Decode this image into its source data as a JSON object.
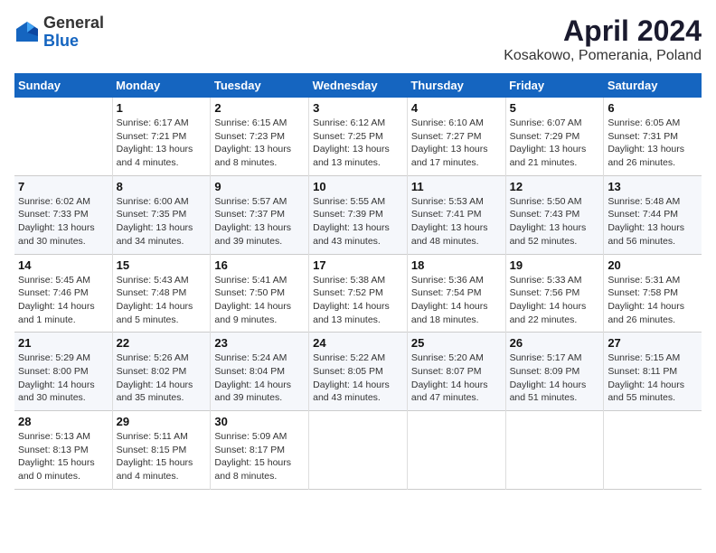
{
  "header": {
    "logo_general": "General",
    "logo_blue": "Blue",
    "title": "April 2024",
    "subtitle": "Kosakowo, Pomerania, Poland"
  },
  "days_of_week": [
    "Sunday",
    "Monday",
    "Tuesday",
    "Wednesday",
    "Thursday",
    "Friday",
    "Saturday"
  ],
  "weeks": [
    [
      {
        "day": "",
        "info": ""
      },
      {
        "day": "1",
        "info": "Sunrise: 6:17 AM\nSunset: 7:21 PM\nDaylight: 13 hours\nand 4 minutes."
      },
      {
        "day": "2",
        "info": "Sunrise: 6:15 AM\nSunset: 7:23 PM\nDaylight: 13 hours\nand 8 minutes."
      },
      {
        "day": "3",
        "info": "Sunrise: 6:12 AM\nSunset: 7:25 PM\nDaylight: 13 hours\nand 13 minutes."
      },
      {
        "day": "4",
        "info": "Sunrise: 6:10 AM\nSunset: 7:27 PM\nDaylight: 13 hours\nand 17 minutes."
      },
      {
        "day": "5",
        "info": "Sunrise: 6:07 AM\nSunset: 7:29 PM\nDaylight: 13 hours\nand 21 minutes."
      },
      {
        "day": "6",
        "info": "Sunrise: 6:05 AM\nSunset: 7:31 PM\nDaylight: 13 hours\nand 26 minutes."
      }
    ],
    [
      {
        "day": "7",
        "info": "Sunrise: 6:02 AM\nSunset: 7:33 PM\nDaylight: 13 hours\nand 30 minutes."
      },
      {
        "day": "8",
        "info": "Sunrise: 6:00 AM\nSunset: 7:35 PM\nDaylight: 13 hours\nand 34 minutes."
      },
      {
        "day": "9",
        "info": "Sunrise: 5:57 AM\nSunset: 7:37 PM\nDaylight: 13 hours\nand 39 minutes."
      },
      {
        "day": "10",
        "info": "Sunrise: 5:55 AM\nSunset: 7:39 PM\nDaylight: 13 hours\nand 43 minutes."
      },
      {
        "day": "11",
        "info": "Sunrise: 5:53 AM\nSunset: 7:41 PM\nDaylight: 13 hours\nand 48 minutes."
      },
      {
        "day": "12",
        "info": "Sunrise: 5:50 AM\nSunset: 7:43 PM\nDaylight: 13 hours\nand 52 minutes."
      },
      {
        "day": "13",
        "info": "Sunrise: 5:48 AM\nSunset: 7:44 PM\nDaylight: 13 hours\nand 56 minutes."
      }
    ],
    [
      {
        "day": "14",
        "info": "Sunrise: 5:45 AM\nSunset: 7:46 PM\nDaylight: 14 hours\nand 1 minute."
      },
      {
        "day": "15",
        "info": "Sunrise: 5:43 AM\nSunset: 7:48 PM\nDaylight: 14 hours\nand 5 minutes."
      },
      {
        "day": "16",
        "info": "Sunrise: 5:41 AM\nSunset: 7:50 PM\nDaylight: 14 hours\nand 9 minutes."
      },
      {
        "day": "17",
        "info": "Sunrise: 5:38 AM\nSunset: 7:52 PM\nDaylight: 14 hours\nand 13 minutes."
      },
      {
        "day": "18",
        "info": "Sunrise: 5:36 AM\nSunset: 7:54 PM\nDaylight: 14 hours\nand 18 minutes."
      },
      {
        "day": "19",
        "info": "Sunrise: 5:33 AM\nSunset: 7:56 PM\nDaylight: 14 hours\nand 22 minutes."
      },
      {
        "day": "20",
        "info": "Sunrise: 5:31 AM\nSunset: 7:58 PM\nDaylight: 14 hours\nand 26 minutes."
      }
    ],
    [
      {
        "day": "21",
        "info": "Sunrise: 5:29 AM\nSunset: 8:00 PM\nDaylight: 14 hours\nand 30 minutes."
      },
      {
        "day": "22",
        "info": "Sunrise: 5:26 AM\nSunset: 8:02 PM\nDaylight: 14 hours\nand 35 minutes."
      },
      {
        "day": "23",
        "info": "Sunrise: 5:24 AM\nSunset: 8:04 PM\nDaylight: 14 hours\nand 39 minutes."
      },
      {
        "day": "24",
        "info": "Sunrise: 5:22 AM\nSunset: 8:05 PM\nDaylight: 14 hours\nand 43 minutes."
      },
      {
        "day": "25",
        "info": "Sunrise: 5:20 AM\nSunset: 8:07 PM\nDaylight: 14 hours\nand 47 minutes."
      },
      {
        "day": "26",
        "info": "Sunrise: 5:17 AM\nSunset: 8:09 PM\nDaylight: 14 hours\nand 51 minutes."
      },
      {
        "day": "27",
        "info": "Sunrise: 5:15 AM\nSunset: 8:11 PM\nDaylight: 14 hours\nand 55 minutes."
      }
    ],
    [
      {
        "day": "28",
        "info": "Sunrise: 5:13 AM\nSunset: 8:13 PM\nDaylight: 15 hours\nand 0 minutes."
      },
      {
        "day": "29",
        "info": "Sunrise: 5:11 AM\nSunset: 8:15 PM\nDaylight: 15 hours\nand 4 minutes."
      },
      {
        "day": "30",
        "info": "Sunrise: 5:09 AM\nSunset: 8:17 PM\nDaylight: 15 hours\nand 8 minutes."
      },
      {
        "day": "",
        "info": ""
      },
      {
        "day": "",
        "info": ""
      },
      {
        "day": "",
        "info": ""
      },
      {
        "day": "",
        "info": ""
      }
    ]
  ]
}
